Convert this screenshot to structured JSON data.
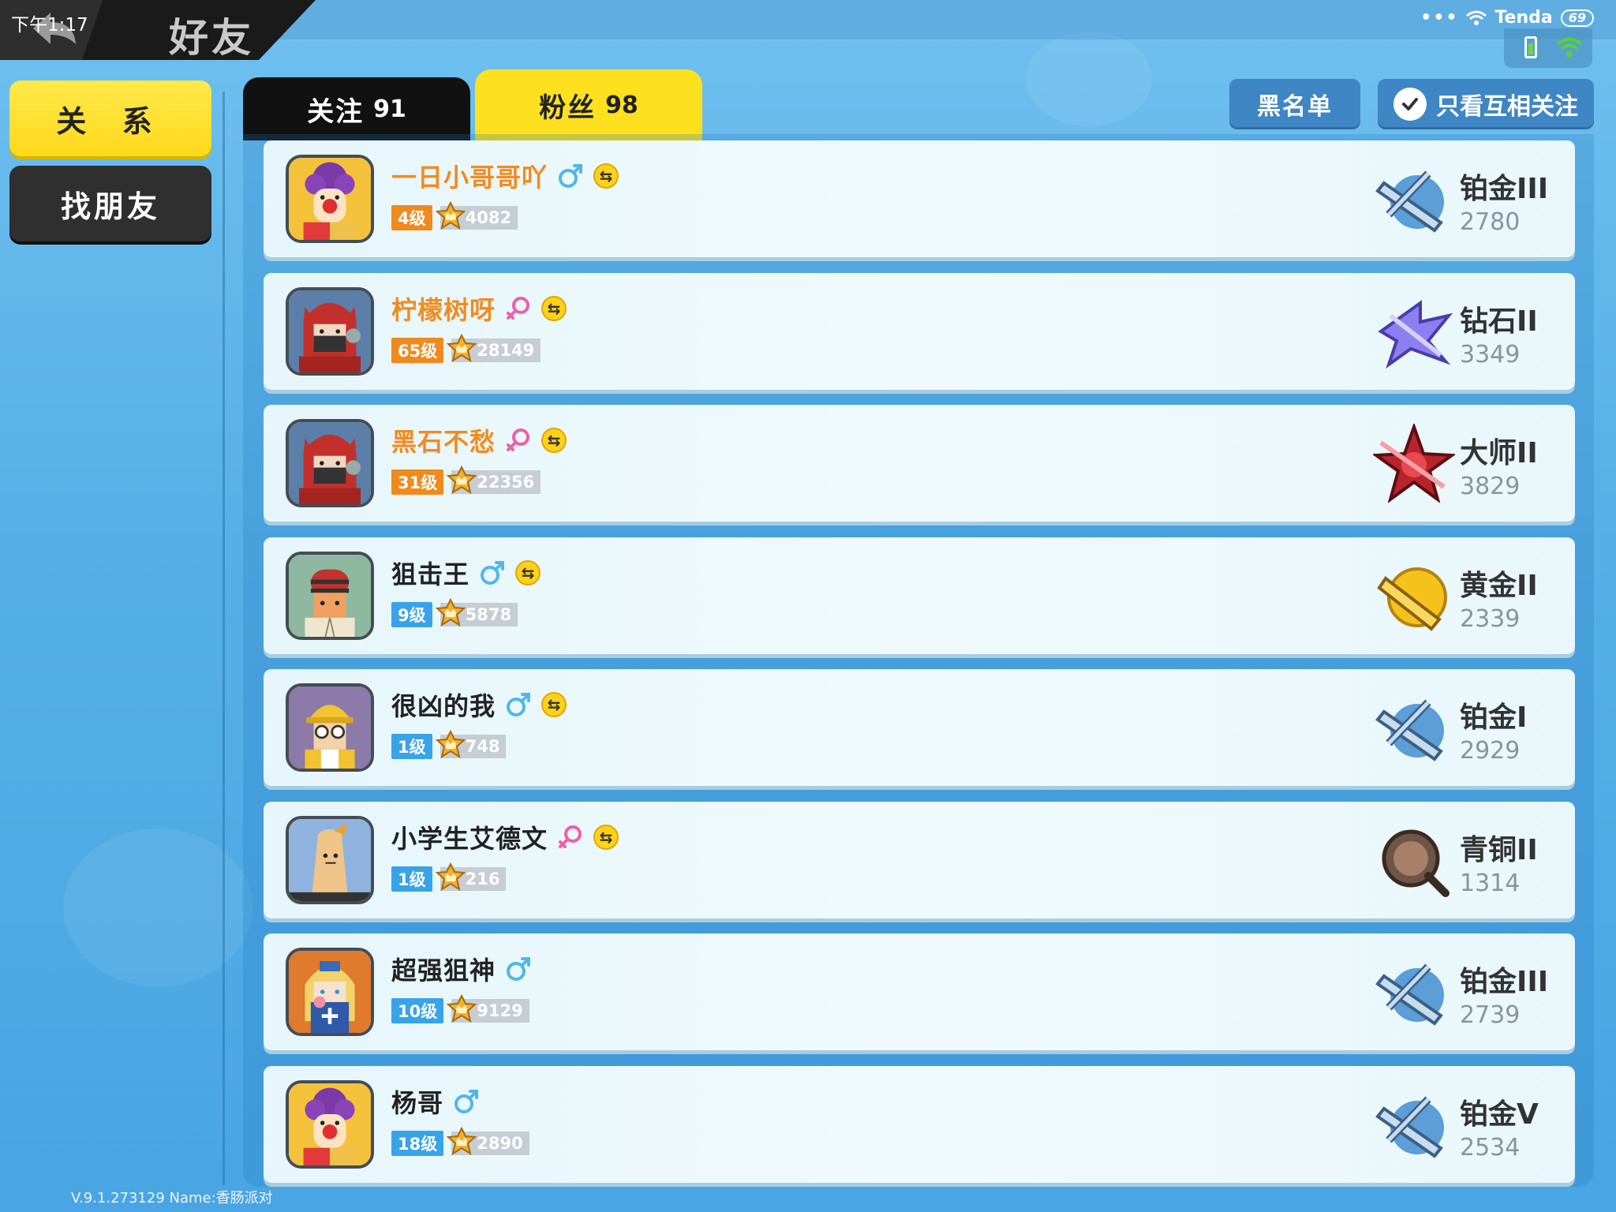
{
  "status_bar": {
    "time": "下午1:17",
    "network_name": "Tenda",
    "battery": "69",
    "more": "•••"
  },
  "header": {
    "title": "好友"
  },
  "nav": {
    "relation_label": "关 系",
    "find_friends_label": "找朋友"
  },
  "tabs": {
    "follow": {
      "label": "关注",
      "count": "91"
    },
    "fans": {
      "label": "粉丝",
      "count": "98"
    }
  },
  "actions": {
    "blacklist_label": "黑名单",
    "mutual_only_label": "只看互相关注"
  },
  "friends": [
    {
      "name": "一日小哥哥吖",
      "gender": "male",
      "mutual": true,
      "level": "4级",
      "level_color": "orange",
      "score": "4082",
      "rank_name": "铂金III",
      "rank_points": "2780",
      "rank_icon": "platinum-emblem",
      "avatar": "clown",
      "name_color": "orange"
    },
    {
      "name": "柠檬树呀",
      "gender": "female",
      "mutual": true,
      "level": "65级",
      "level_color": "orange",
      "score": "28149",
      "rank_name": "钻石II",
      "rank_points": "3349",
      "rank_icon": "diamond-emblem",
      "avatar": "red-hood",
      "name_color": "orange"
    },
    {
      "name": "黑石不愁",
      "gender": "female",
      "mutual": true,
      "level": "31级",
      "level_color": "orange",
      "score": "22356",
      "rank_name": "大师II",
      "rank_points": "3829",
      "rank_icon": "master-emblem",
      "avatar": "red-hood",
      "name_color": "orange"
    },
    {
      "name": "狙击王",
      "gender": "male",
      "mutual": true,
      "level": "9级",
      "level_color": "blue",
      "score": "5878",
      "rank_name": "黄金II",
      "rank_points": "2339",
      "rank_icon": "gold-emblem",
      "avatar": "beanie",
      "name_color": "dark"
    },
    {
      "name": "很凶的我",
      "gender": "male",
      "mutual": true,
      "level": "1级",
      "level_color": "blue",
      "score": "748",
      "rank_name": "铂金I",
      "rank_points": "2929",
      "rank_icon": "platinum-emblem",
      "avatar": "miner",
      "name_color": "dark"
    },
    {
      "name": "小学生艾德文",
      "gender": "female",
      "mutual": true,
      "level": "1级",
      "level_color": "blue",
      "score": "216",
      "rank_name": "青铜II",
      "rank_points": "1314",
      "rank_icon": "bronze-emblem",
      "avatar": "sausage",
      "name_color": "dark"
    },
    {
      "name": "超强狙神",
      "gender": "male",
      "mutual": false,
      "level": "10级",
      "level_color": "blue",
      "score": "9129",
      "rank_name": "铂金III",
      "rank_points": "2739",
      "rank_icon": "platinum-emblem",
      "avatar": "nurse",
      "name_color": "dark"
    },
    {
      "name": "杨哥",
      "gender": "male",
      "mutual": false,
      "level": "18级",
      "level_color": "blue",
      "score": "2890",
      "rank_name": "铂金V",
      "rank_points": "2534",
      "rank_icon": "platinum-emblem",
      "avatar": "clown",
      "name_color": "dark"
    }
  ],
  "mutual_glyph": "⇆",
  "footer": {
    "version_text": "V.9.1.273129 Name:香肠派对"
  },
  "colors": {
    "accent_yellow": "#fde11e",
    "background_blue": "#56afe7",
    "orange_name": "#f28b1e",
    "level_blue": "#38a3e8"
  }
}
